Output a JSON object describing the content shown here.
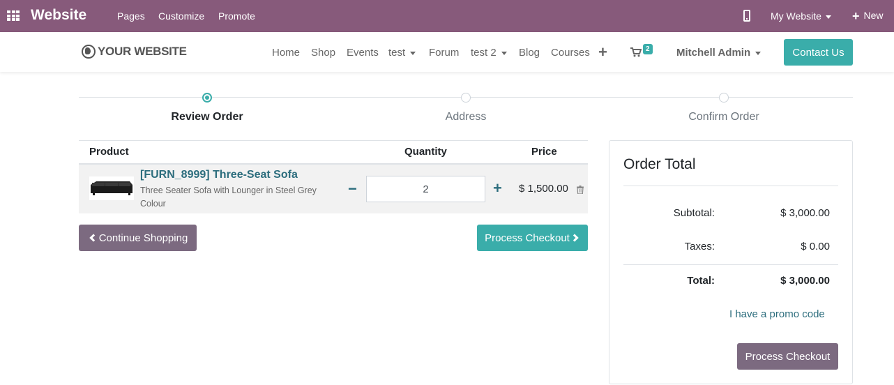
{
  "adminbar": {
    "brand": "Website",
    "menu": [
      "Pages",
      "Customize",
      "Promote"
    ],
    "site_selector": "My Website",
    "new_label": "New"
  },
  "header": {
    "logo": "YOUR WEBSITE",
    "nav": [
      "Home",
      "Shop",
      "Events",
      "test",
      "Forum",
      "test 2",
      "Blog",
      "Courses"
    ],
    "cart_count": "2",
    "user": "Mitchell Admin",
    "contact": "Contact Us"
  },
  "wizard": {
    "steps": [
      "Review Order",
      "Address",
      "Confirm Order"
    ],
    "active_step": 0
  },
  "cart": {
    "columns": [
      "Product",
      "Quantity",
      "Price"
    ],
    "lines": [
      {
        "name": "[FURN_8999] Three-Seat Sofa",
        "description": "Three Seater Sofa with Lounger in Steel Grey Colour",
        "quantity": "2",
        "price": "$ 1,500.00"
      }
    ],
    "continue_label": "Continue Shopping",
    "checkout_label": "Process Checkout"
  },
  "summary": {
    "title": "Order Total",
    "subtotal_label": "Subtotal:",
    "subtotal": "$ 3,000.00",
    "taxes_label": "Taxes:",
    "taxes": "$ 0.00",
    "total_label": "Total:",
    "total": "$ 3,000.00",
    "promo": "I have a promo code",
    "checkout_label": "Process Checkout"
  },
  "colors": {
    "brand": "#875a7b",
    "accent": "#3aadaa",
    "secondary_button": "#7c6a80",
    "link": "#2c6d7d"
  }
}
